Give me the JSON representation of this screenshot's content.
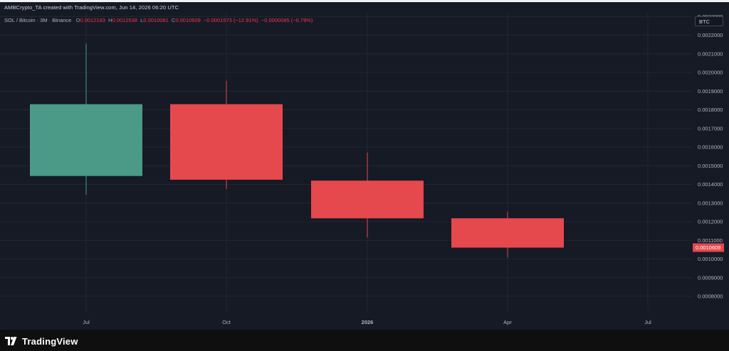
{
  "header": {
    "credit": "AMBCrypto_TA created with TradingView.com, Jun 14, 2026 06:20 UTC"
  },
  "legend": {
    "symbol": "SOL / Bitcoin · 3M · Binance",
    "open_key": "O",
    "open": "0.0012183",
    "high_key": "H",
    "high": "0.0012538",
    "low_key": "L",
    "low": "0.0010081",
    "close_key": "C",
    "close": "0.0010609",
    "change": "−0.0001573 (−12.91%)",
    "change2": "−0.0000085 (−0.79%)"
  },
  "currency_button": "BTC",
  "brand": {
    "name": "TradingView"
  },
  "colors": {
    "up": "#4a9a87",
    "down": "#e5484d",
    "background": "#161a25",
    "grid": "#232735"
  },
  "chart_data": {
    "type": "candlestick",
    "title": "",
    "y_axis": {
      "min": 0.00072,
      "max": 0.00232,
      "ticks": [
        "0.0008000",
        "0.0009000",
        "0.0010000",
        "0.0011000",
        "0.0012000",
        "0.0013000",
        "0.0014000",
        "0.0015000",
        "0.0016000",
        "0.0017000",
        "0.0018000",
        "0.0019000",
        "0.0020000",
        "0.0021000",
        "0.0022000",
        "0.0023000"
      ],
      "tick_values": [
        0.0008,
        0.0009,
        0.001,
        0.0011,
        0.0012,
        0.0013,
        0.0014,
        0.0015,
        0.0016,
        0.0017,
        0.0018,
        0.0019,
        0.002,
        0.0021,
        0.0022,
        0.0023
      ],
      "last_price_label": "0.0010609",
      "last_price": 0.0010609
    },
    "x_axis": {
      "labels": [
        "Jul",
        "Oct",
        "2026",
        "Apr",
        "Jul"
      ],
      "bold": [
        false,
        false,
        true,
        false,
        false
      ]
    },
    "candles": [
      {
        "open": 0.001445,
        "high": 0.002155,
        "low": 0.001345,
        "close": 0.00183
      },
      {
        "open": 0.00183,
        "high": 0.001955,
        "low": 0.001375,
        "close": 0.001425
      },
      {
        "open": 0.00142,
        "high": 0.00157,
        "low": 0.001115,
        "close": 0.001218
      },
      {
        "open": 0.0012183,
        "high": 0.0012538,
        "low": 0.0010081,
        "close": 0.0010609
      }
    ],
    "grid": true
  }
}
